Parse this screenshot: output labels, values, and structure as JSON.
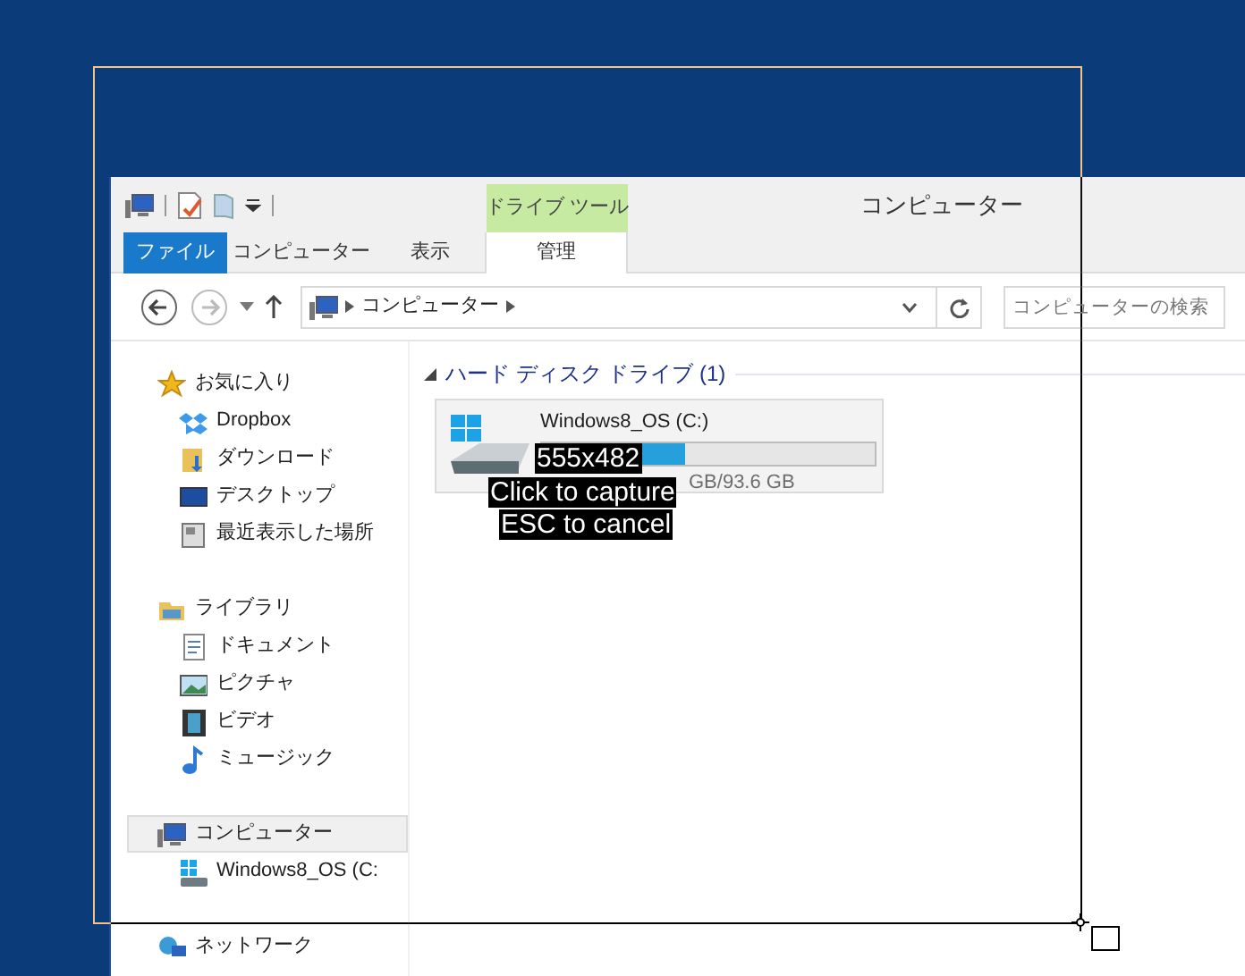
{
  "window": {
    "title": "コンピューター"
  },
  "ribbon": {
    "context_group": "ドライブ ツール",
    "tabs": [
      {
        "label": "ファイル",
        "kind": "file"
      },
      {
        "label": "コンピューター",
        "kind": "plain"
      },
      {
        "label": "表示",
        "kind": "plain"
      },
      {
        "label": "管理",
        "kind": "context"
      }
    ]
  },
  "address": {
    "path": [
      "コンピューター"
    ],
    "search_placeholder": "コンピューターの検索"
  },
  "navigation": [
    {
      "label": "お気に入り",
      "selected": false,
      "children": [
        {
          "label": "Dropbox",
          "selected": false
        },
        {
          "label": "ダウンロード",
          "selected": false
        },
        {
          "label": "デスクトップ",
          "selected": false
        },
        {
          "label": "最近表示した場所",
          "selected": false
        }
      ]
    },
    {
      "label": "ライブラリ",
      "selected": false,
      "children": [
        {
          "label": "ドキュメント",
          "selected": false
        },
        {
          "label": "ピクチャ",
          "selected": false
        },
        {
          "label": "ビデオ",
          "selected": false
        },
        {
          "label": "ミュージック",
          "selected": false
        }
      ]
    },
    {
      "label": "コンピューター",
      "selected": true,
      "children": [
        {
          "label": "Windows8_OS (C:",
          "selected": false
        }
      ]
    },
    {
      "label": "ネットワーク",
      "selected": false
    }
  ],
  "group": {
    "title": "ハード ディスク ドライブ (1)",
    "expanded": true
  },
  "drives": [
    {
      "name": "Windows8_OS (C:)",
      "level": 0.43,
      "space": "GB/93.6 GB"
    }
  ],
  "capture": {
    "size": "555x482",
    "hints": [
      "Click to capture",
      "ESC to cancel"
    ]
  }
}
